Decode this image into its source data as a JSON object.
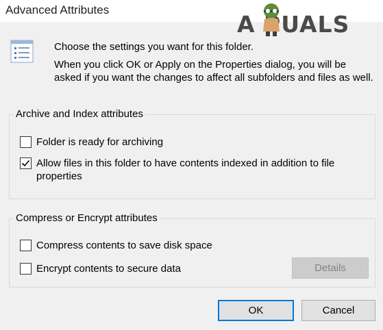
{
  "window": {
    "title": "Advanced Attributes"
  },
  "watermark": {
    "text": "APPUALS",
    "display": "A  PUALS"
  },
  "info": {
    "icon": "folder-properties-icon",
    "line1": "Choose the settings you want for this folder.",
    "line2": "When you click OK or Apply on the Properties dialog, you will be asked if you want the changes to affect all subfolders and files as well."
  },
  "archive_group": {
    "label": "Archive and Index attributes",
    "options": [
      {
        "label": "Folder is ready for archiving",
        "checked": false
      },
      {
        "label": "Allow files in this folder to have contents indexed in addition to file properties",
        "checked": true
      }
    ]
  },
  "compress_group": {
    "label": "Compress or Encrypt attributes",
    "options": [
      {
        "label": "Compress contents to save disk space",
        "checked": false
      },
      {
        "label": "Encrypt contents to secure data",
        "checked": false
      }
    ],
    "details_label": "Details"
  },
  "buttons": {
    "ok": "OK",
    "cancel": "Cancel"
  },
  "colors": {
    "dialog_bg": "#f0f0f0",
    "accent": "#0078d7",
    "disabled_bg": "#cccccc"
  }
}
